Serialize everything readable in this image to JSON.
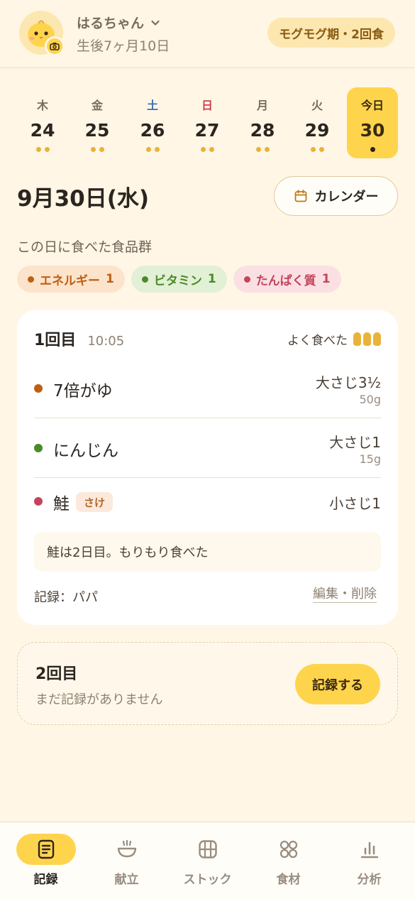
{
  "header": {
    "baby_name": "はるちゃん",
    "age": "生後7ヶ月10日",
    "stage_badge": "モグモグ期・2回食"
  },
  "week": [
    {
      "dow": "木",
      "num": "24",
      "dots": 2,
      "type": "weekday"
    },
    {
      "dow": "金",
      "num": "25",
      "dots": 2,
      "type": "weekday"
    },
    {
      "dow": "土",
      "num": "26",
      "dots": 2,
      "type": "sat"
    },
    {
      "dow": "日",
      "num": "27",
      "dots": 2,
      "type": "sun"
    },
    {
      "dow": "月",
      "num": "28",
      "dots": 2,
      "type": "weekday"
    },
    {
      "dow": "火",
      "num": "29",
      "dots": 2,
      "type": "weekday"
    },
    {
      "dow": "今日",
      "num": "30",
      "dots": 1,
      "type": "today"
    }
  ],
  "date_title": "9月30日(水)",
  "calendar_button": "カレンダー",
  "food_groups_label": "この日に食べた食品群",
  "food_groups": {
    "energy": {
      "label": "エネルギー",
      "count": "1",
      "color": "#C05E12"
    },
    "vitamin": {
      "label": "ビタミン",
      "count": "1",
      "color": "#4B8A2A"
    },
    "protein": {
      "label": "たんぱく質",
      "count": "1",
      "color": "#C4445E"
    }
  },
  "meal1": {
    "title": "1回目",
    "time": "10:05",
    "appetite_label": "よく食べた",
    "appetite_level": 3,
    "foods": [
      {
        "name": "7倍がゆ",
        "amount": "大さじ3½",
        "grams": "50g",
        "group": "energy"
      },
      {
        "name": "にんじん",
        "amount": "大さじ1",
        "grams": "15g",
        "group": "vitamin"
      },
      {
        "name": "鮭",
        "tag": "さけ",
        "amount": "小さじ1",
        "group": "protein"
      }
    ],
    "memo": "鮭は2日目。もりもり食べた",
    "recorder": "記録：パパ",
    "edit_link": "編集・削除"
  },
  "meal2": {
    "title": "2回目",
    "empty_text": "まだ記録がありません",
    "record_button": "記録する"
  },
  "nav": [
    {
      "label": "記録",
      "icon": "record-icon",
      "active": true
    },
    {
      "label": "献立",
      "icon": "bowl-icon",
      "active": false
    },
    {
      "label": "ストック",
      "icon": "ice-tray-icon",
      "active": false
    },
    {
      "label": "食材",
      "icon": "ingredients-icon",
      "active": false
    },
    {
      "label": "分析",
      "icon": "chart-icon",
      "active": false
    }
  ],
  "colors": {
    "accent": "#FFD44D",
    "background": "#FFF6E5",
    "dot": "#E8B33A"
  }
}
